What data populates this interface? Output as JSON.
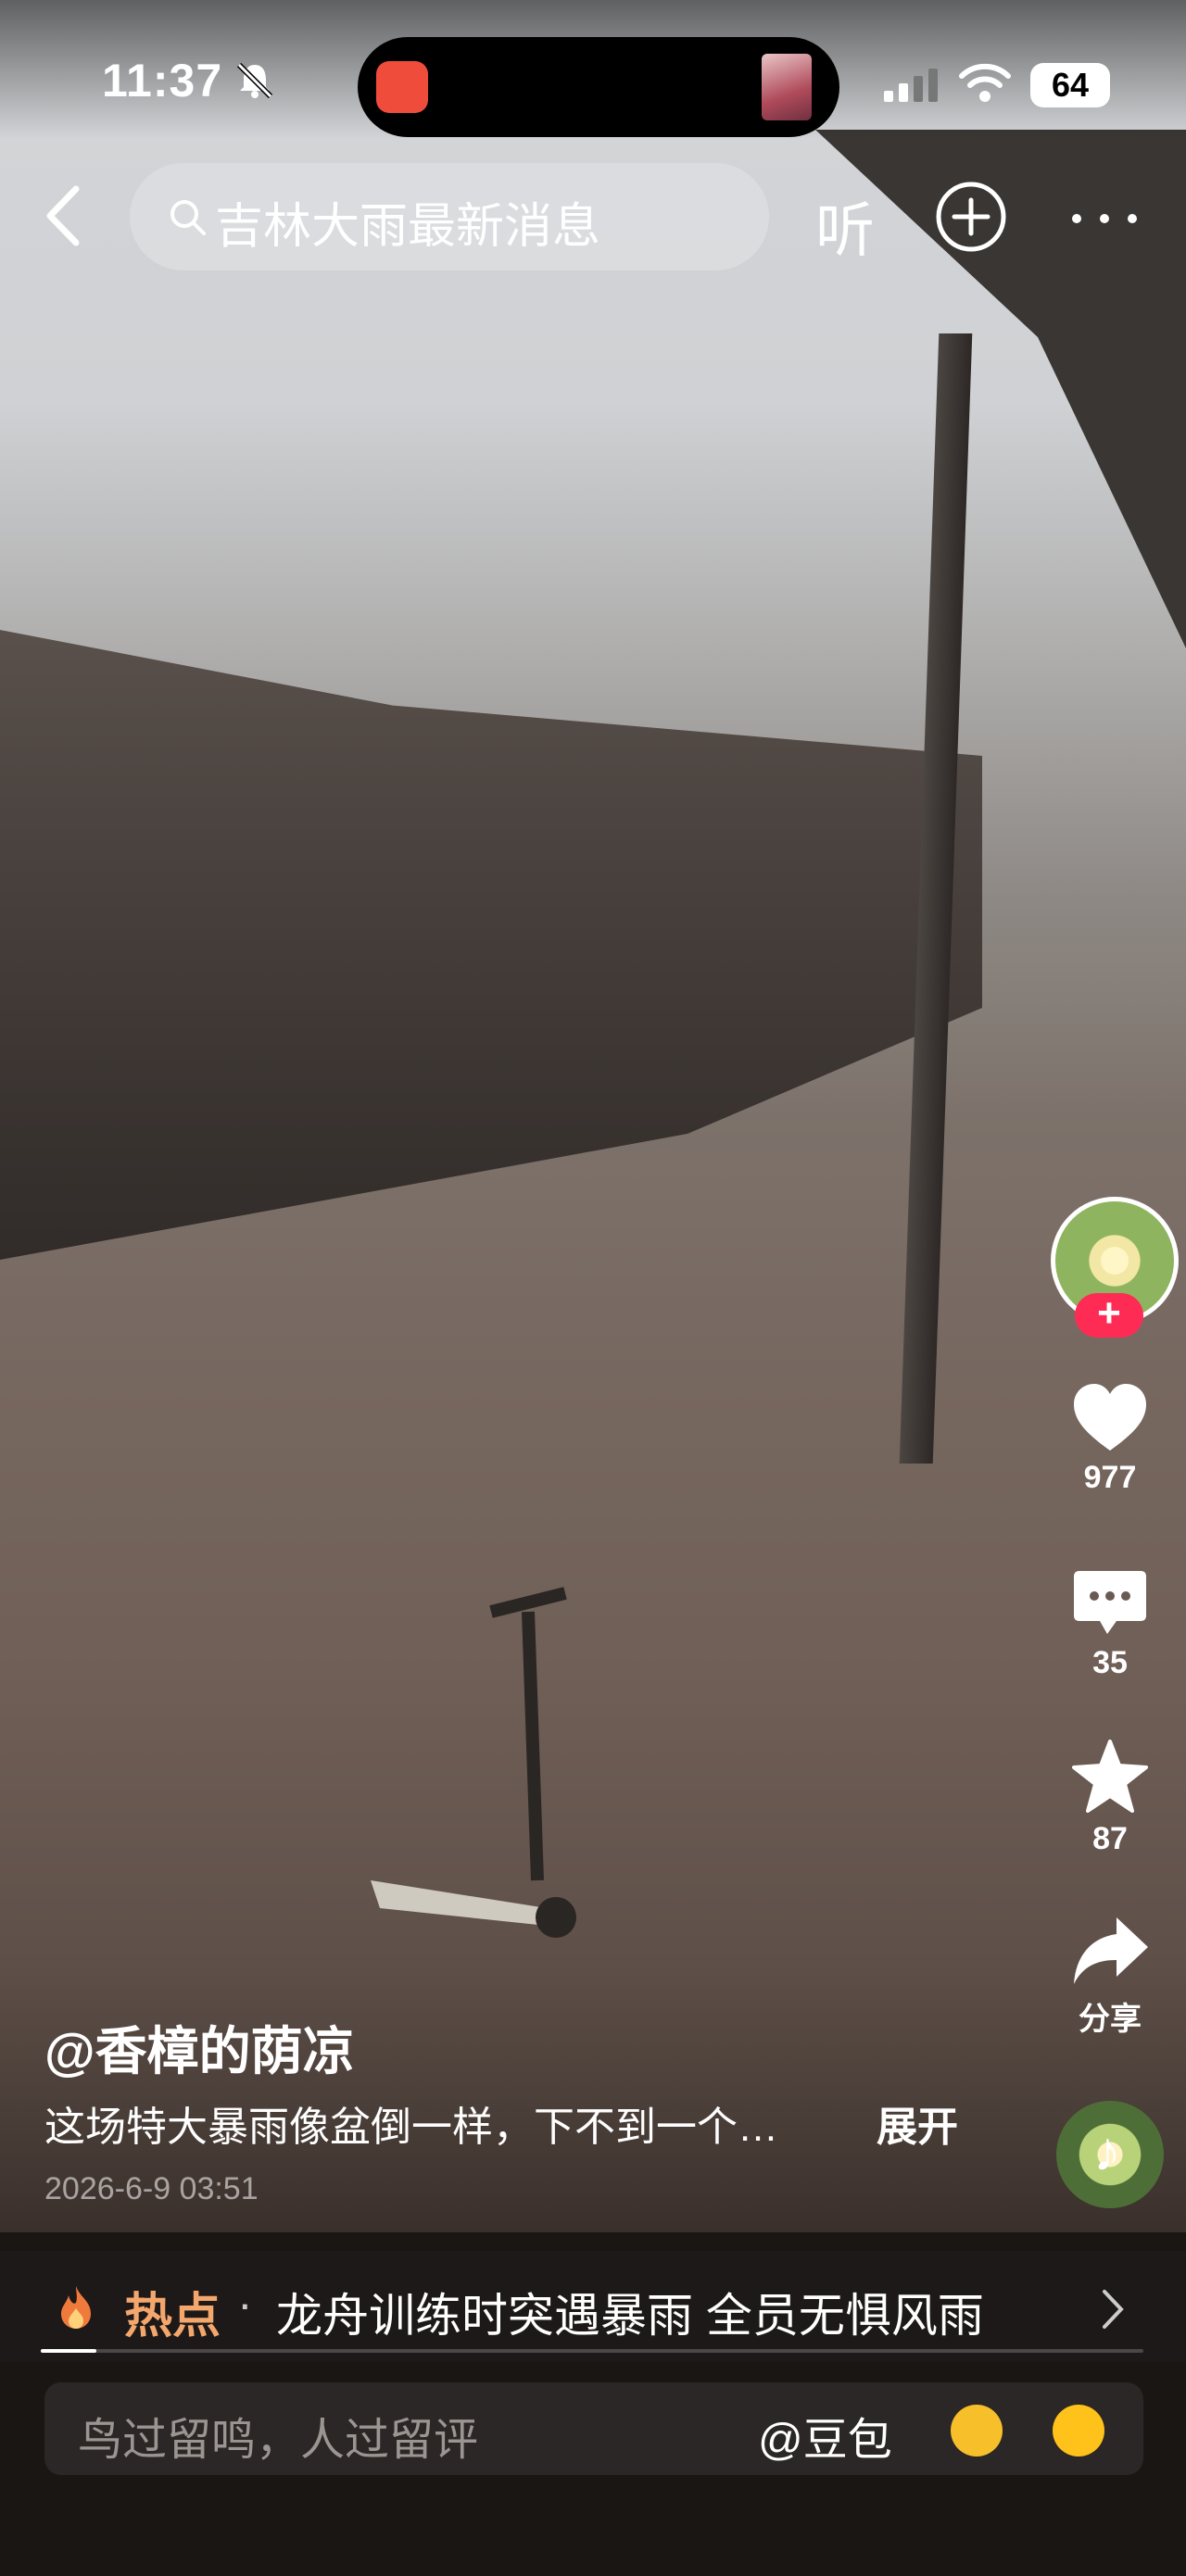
{
  "status_bar": {
    "time": "11:37",
    "battery": "64"
  },
  "top_nav": {
    "search_text": "吉林大雨最新消息",
    "listen_label": "听"
  },
  "actions": {
    "likes": "977",
    "comments": "35",
    "favorites": "87",
    "share_label": "分享"
  },
  "post": {
    "author": "@香樟的荫凉",
    "description": "这场特大暴雨像盆倒一样，下不到一个…",
    "expand_label": "展开",
    "date": "2026-6-9 03:51"
  },
  "hot": {
    "tag": "热点",
    "separator": "·",
    "headline": "龙舟训练时突遇暴雨 全员无惧风雨"
  },
  "playback_progress": 0.05,
  "comment_input": {
    "placeholder": "鸟过留鸣，人过留评",
    "mention": "@豆包"
  },
  "colors": {
    "accent_red": "#fe2c55",
    "hot_orange": "#f4a76d"
  }
}
